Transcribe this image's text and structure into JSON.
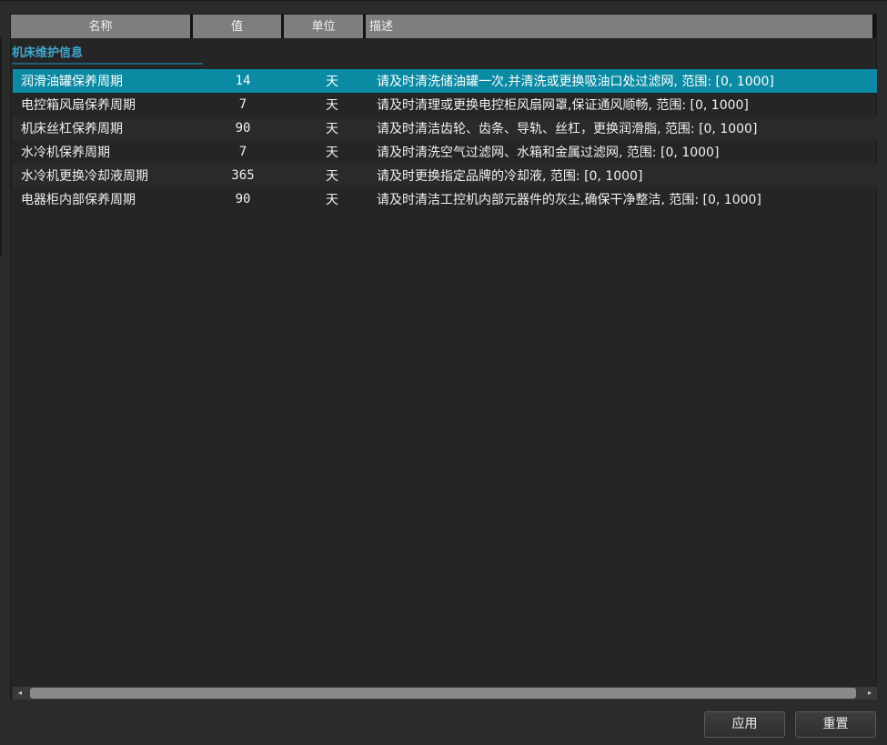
{
  "table": {
    "columns": [
      "名称",
      "值",
      "单位",
      "描述"
    ],
    "section_title": "机床维护信息",
    "rows": [
      {
        "name": "润滑油罐保养周期",
        "value": "14",
        "unit": "天",
        "desc": "请及时清洗储油罐一次,并清洗或更换吸油口处过滤网, 范围: [0, 1000]"
      },
      {
        "name": "电控箱风扇保养周期",
        "value": "7",
        "unit": "天",
        "desc": "请及时清理或更换电控柜风扇网罩,保证通风顺畅, 范围: [0, 1000]"
      },
      {
        "name": "机床丝杠保养周期",
        "value": "90",
        "unit": "天",
        "desc": "请及时清洁齿轮、齿条、导轨、丝杠，更换润滑脂, 范围: [0, 1000]"
      },
      {
        "name": "水冷机保养周期",
        "value": "7",
        "unit": "天",
        "desc": "请及时清洗空气过滤网、水箱和金属过滤网, 范围: [0, 1000]"
      },
      {
        "name": "水冷机更换冷却液周期",
        "value": "365",
        "unit": "天",
        "desc": "请及时更换指定品牌的冷却液, 范围: [0, 1000]"
      },
      {
        "name": "电器柜内部保养周期",
        "value": "90",
        "unit": "天",
        "desc": "请及时清洁工控机内部元器件的灰尘,确保干净整洁, 范围: [0, 1000]"
      }
    ]
  },
  "buttons": {
    "apply": "应用",
    "reset": "重置"
  },
  "scrollbar": {
    "left_icon": "◂",
    "right_icon": "▸"
  },
  "colors": {
    "selected_row": "#0a8aa3",
    "section_title": "#3fa7d0"
  }
}
